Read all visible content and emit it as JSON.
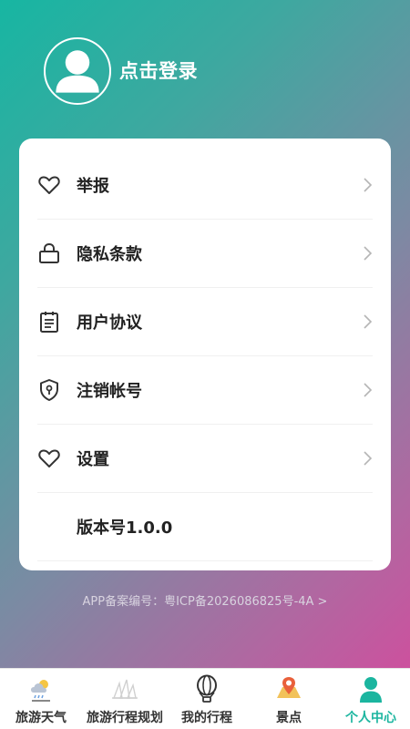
{
  "header": {
    "login_label": "点击登录"
  },
  "menu": {
    "items": [
      {
        "label": "举报",
        "icon": "heart-icon"
      },
      {
        "label": "隐私条款",
        "icon": "lock-icon"
      },
      {
        "label": "用户协议",
        "icon": "clipboard-icon"
      },
      {
        "label": "注销帐号",
        "icon": "shield-icon"
      },
      {
        "label": "设置",
        "icon": "heart-icon"
      }
    ],
    "version": "版本号1.0.0"
  },
  "icp": "APP备案编号：粤ICP备2026086825号-4A >",
  "tabbar": {
    "tabs": [
      {
        "label": "旅游天气",
        "icon": "weather-icon"
      },
      {
        "label": "旅游行程规划",
        "icon": "landmark-icon"
      },
      {
        "label": "我的行程",
        "icon": "hot-air-balloon-icon"
      },
      {
        "label": "景点",
        "icon": "map-pin-icon"
      },
      {
        "label": "个人中心",
        "icon": "person-icon"
      }
    ],
    "active": 4
  },
  "colors": {
    "accent": "#1bb59f",
    "gradient_start": "#17b6a2",
    "gradient_end": "#d6499d"
  }
}
